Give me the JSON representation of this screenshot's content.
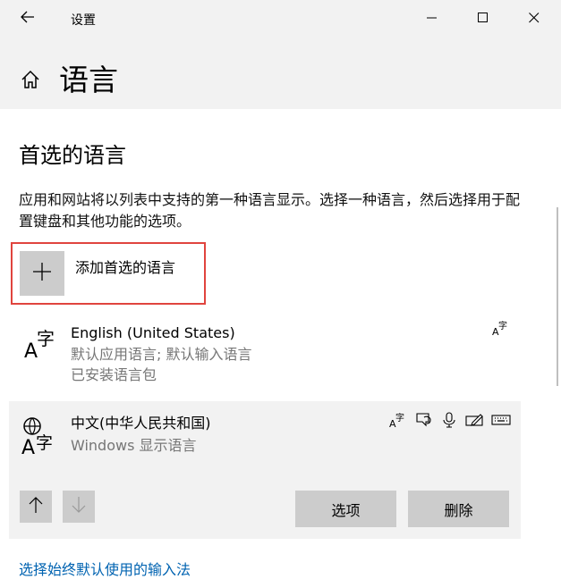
{
  "window": {
    "app_title": "设置"
  },
  "header": {
    "page_title": "语言"
  },
  "preferred": {
    "section_title": "首选的语言",
    "description": "应用和网站将以列表中支持的第一种语言显示。选择一种语言，然后选择用于配置键盘和其他功能的选项。",
    "add_label": "添加首选的语言"
  },
  "languages": [
    {
      "name": "English (United States)",
      "sub1": "默认应用语言; 默认输入语言",
      "sub2": "已安装语言包",
      "features": [
        "language-pack-icon"
      ]
    },
    {
      "name": "中文(中华人民共和国)",
      "sub1": "Windows 显示语言",
      "features": [
        "language-pack-icon",
        "speech-bubble-display-icon",
        "microphone-icon",
        "handwriting-icon",
        "keyboard-icon"
      ]
    }
  ],
  "actions": {
    "options_label": "选项",
    "remove_label": "删除"
  },
  "footer": {
    "link": "选择始终默认使用的输入法"
  },
  "colors": {
    "highlight_border": "#e0443e",
    "link": "#0063b1",
    "secondary_text": "#767676",
    "panel_bg": "#f2f2f2",
    "button_bg": "#cccccc"
  }
}
